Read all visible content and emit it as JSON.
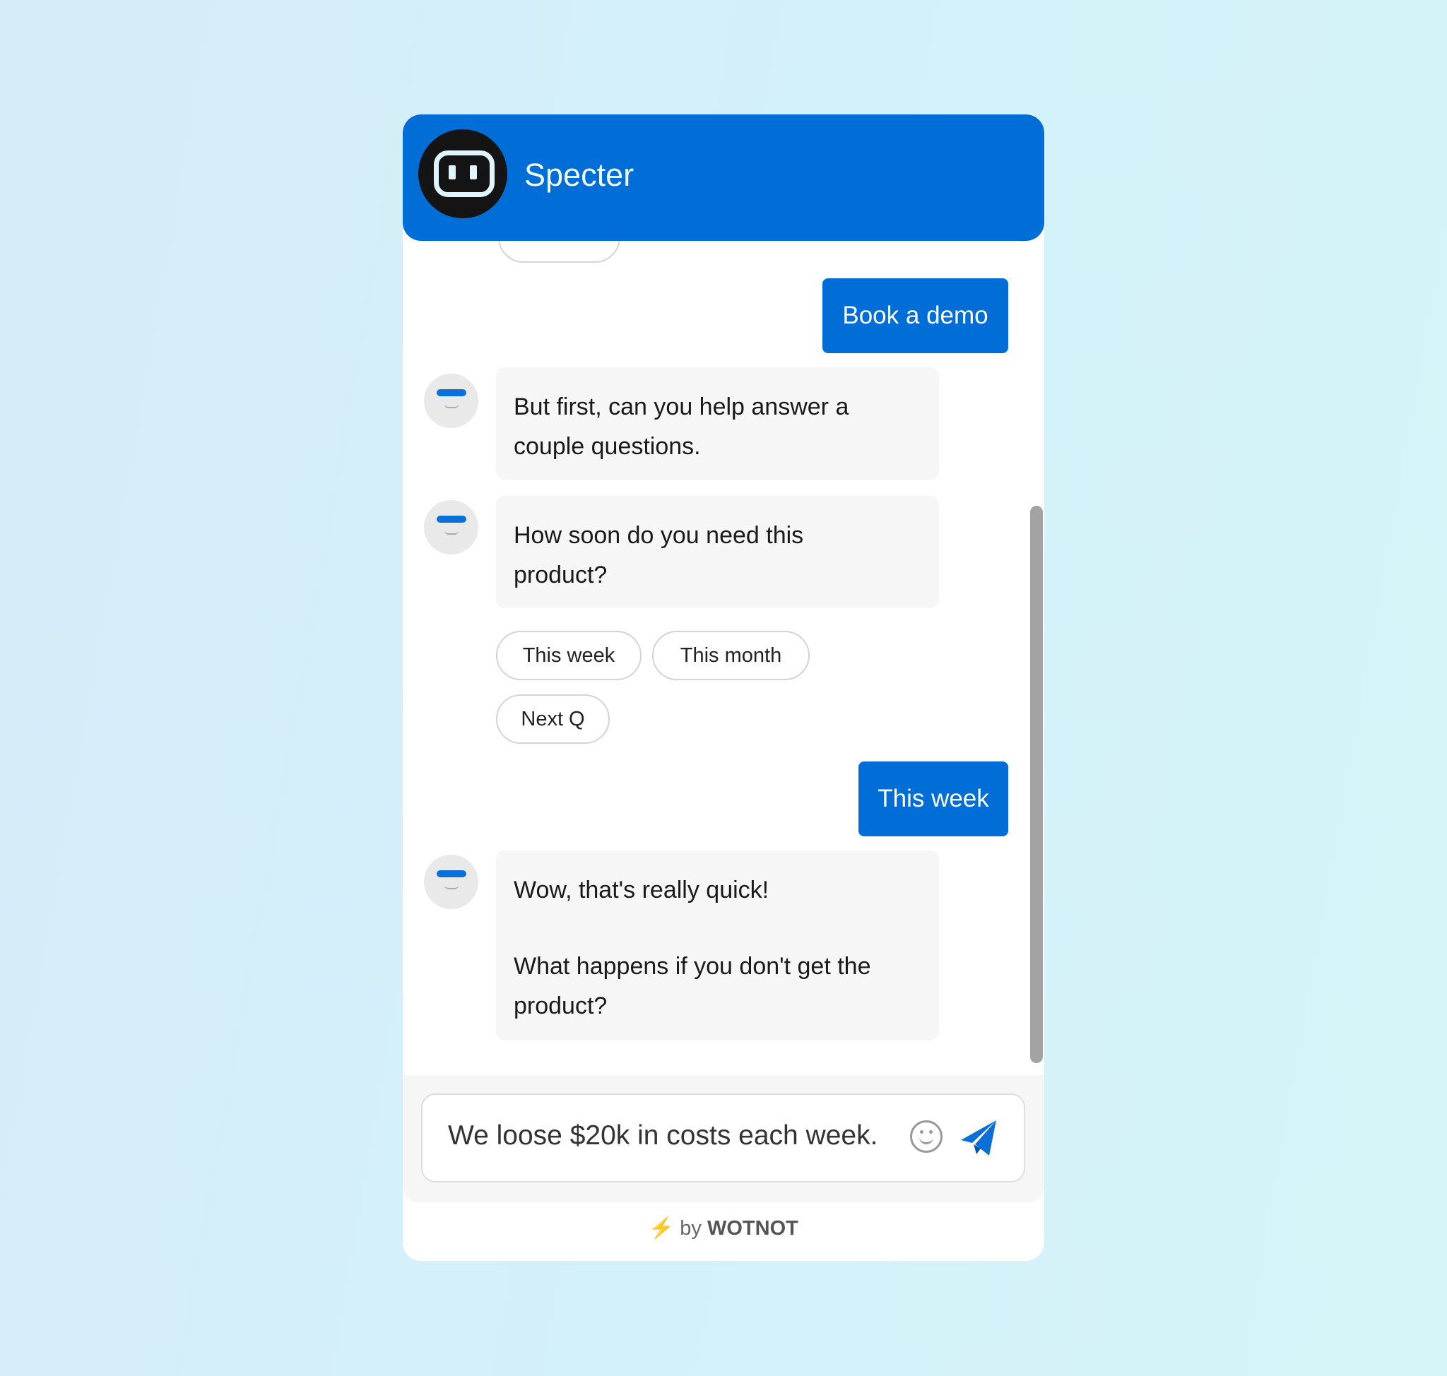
{
  "header": {
    "title": "Specter",
    "logo_icon": "robot-face-icon"
  },
  "colors": {
    "brand": "#006ed6",
    "bot_bubble": "#f6f6f6"
  },
  "messages": [
    {
      "from": "user",
      "text": "Book a demo"
    },
    {
      "from": "bot",
      "text": "But first, can you help answer a couple questions."
    },
    {
      "from": "bot",
      "text": "How soon do you need this product?"
    },
    {
      "from": "user",
      "text": "This week"
    },
    {
      "from": "bot",
      "lines": [
        "Wow, that's really quick!",
        "What happens if you don't get the product?"
      ]
    }
  ],
  "quick_replies": [
    "This week",
    "This month",
    "Next Q"
  ],
  "composer": {
    "value": "We loose $20k in costs each week."
  },
  "footer": {
    "by": "by",
    "brand": "WOTNOT"
  }
}
